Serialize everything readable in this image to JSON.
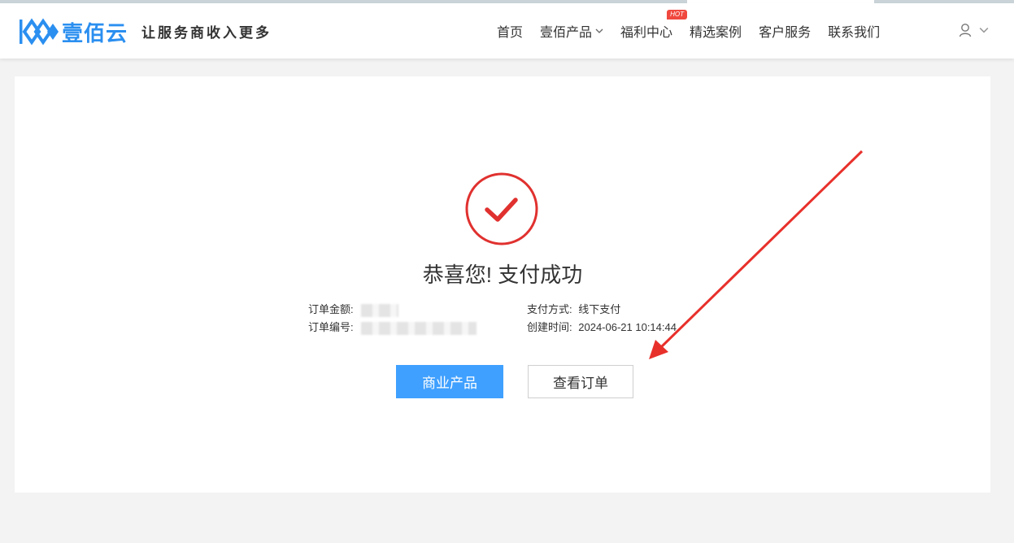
{
  "brand": {
    "name": "壹佰云",
    "slogan": "让服务商收入更多",
    "color": "#2b8ff0"
  },
  "nav": {
    "items": [
      {
        "label": "首页"
      },
      {
        "label": "壹佰产品"
      },
      {
        "label": "福利中心",
        "badge": "HOT"
      },
      {
        "label": "精选案例"
      },
      {
        "label": "客户服务"
      },
      {
        "label": "联系我们"
      }
    ],
    "user_icon": "user-icon"
  },
  "result": {
    "icon": "check-circle-icon",
    "accent": "#e0312f",
    "title": "恭喜您! 支付成功",
    "amount_label": "订单金额:",
    "order_no_label": "订单编号:",
    "pay_method_label": "支付方式:",
    "pay_method_value": "线下支付",
    "created_label": "创建时间:",
    "created_value": "2024-06-21 10:14:44"
  },
  "actions": {
    "primary_label": "商业产品",
    "secondary_label": "查看订单",
    "primary_color": "#3fa0ff"
  },
  "annotation": {
    "arrow_color": "#e8302b"
  }
}
